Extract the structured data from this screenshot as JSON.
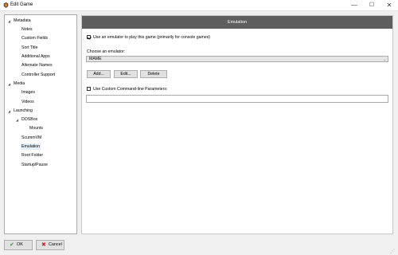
{
  "window": {
    "title": "Edit Game",
    "controls": {
      "minimize": "—",
      "maximize": "☐",
      "close": "✕"
    },
    "icon": "launchbox-icon"
  },
  "sidebar": {
    "groups": [
      {
        "label": "Metadata",
        "expander": "◢",
        "items": [
          "Notes",
          "Custom Fields",
          "Sort Title",
          "Additional Apps",
          "Alternate Names",
          "Controller Support"
        ]
      },
      {
        "label": "Media",
        "expander": "◢",
        "items": [
          "Images",
          "Videos"
        ]
      },
      {
        "label": "Launching",
        "expander": "◢"
      }
    ],
    "launching": {
      "dosbox": {
        "label": "DOSBox",
        "expander": "◢",
        "child": "Mounts"
      },
      "scummvm": "ScummVM",
      "emulation": "Emulation",
      "root_folder": "Root Folder",
      "startup_pause": "Startup/Pause"
    },
    "selected": "Emulation"
  },
  "panel": {
    "header": "Emulation",
    "use_emulator": {
      "checked": true,
      "label": "Use an emulator to play this game (primarily for console games)"
    },
    "choose_label": "Choose an emulator:",
    "emulator_select": {
      "value": "MAME",
      "arrow": "⌄"
    },
    "buttons": {
      "add": "Add...",
      "edit": "Edit...",
      "delete": "Delete"
    },
    "custom_params": {
      "checked": false,
      "label": "Use Custom Command-line Parameters:",
      "value": ""
    }
  },
  "footer": {
    "ok": {
      "label": "OK",
      "icon": "✔"
    },
    "cancel": {
      "label": "Cancel",
      "icon": "✖"
    }
  },
  "colors": {
    "header_bg": "#5e5e5e",
    "ok_icon": "#2e9d2e",
    "cancel_icon": "#d02020",
    "selected_bg": "#e5f0fb"
  }
}
